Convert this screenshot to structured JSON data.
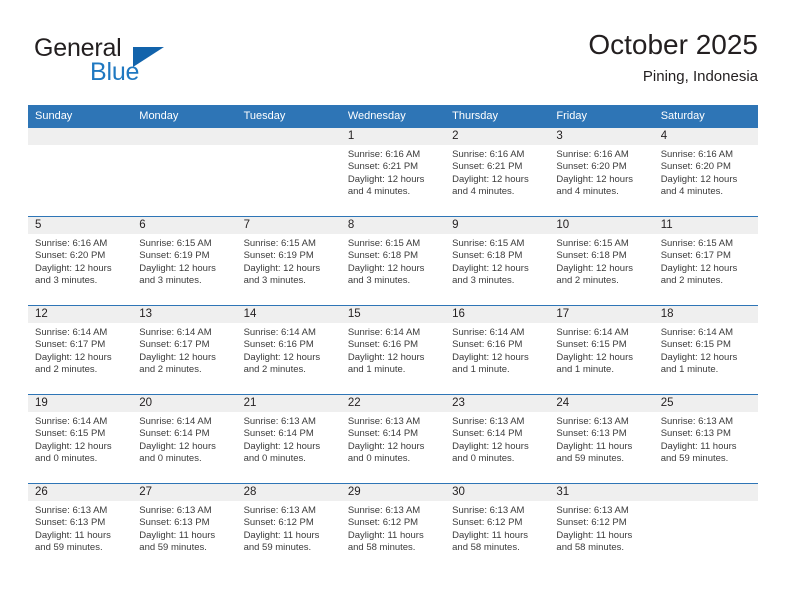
{
  "brand": {
    "word_one": "General",
    "word_two": "Blue",
    "logo_icon": "triangle-flag-icon",
    "accent_color": "#1263ab",
    "text_color": "#1f78c1"
  },
  "header": {
    "title": "October 2025",
    "subtitle": "Pining, Indonesia"
  },
  "theme": {
    "header_band": "#2e75b6",
    "date_band": "#efefef",
    "row_rule": "#2e75b6",
    "body_text": "#3b3b3b"
  },
  "weekday_headers": [
    "Sunday",
    "Monday",
    "Tuesday",
    "Wednesday",
    "Thursday",
    "Friday",
    "Saturday"
  ],
  "labels": {
    "sunrise_prefix": "Sunrise:",
    "sunset_prefix": "Sunset:",
    "daylight_prefix": "Daylight:"
  },
  "weeks": [
    [
      {
        "day": "",
        "empty": true
      },
      {
        "day": "",
        "empty": true
      },
      {
        "day": "",
        "empty": true
      },
      {
        "day": "1",
        "sunrise": "Sunrise: 6:16 AM",
        "sunset": "Sunset: 6:21 PM",
        "daylight": "Daylight: 12 hours and 4 minutes."
      },
      {
        "day": "2",
        "sunrise": "Sunrise: 6:16 AM",
        "sunset": "Sunset: 6:21 PM",
        "daylight": "Daylight: 12 hours and 4 minutes."
      },
      {
        "day": "3",
        "sunrise": "Sunrise: 6:16 AM",
        "sunset": "Sunset: 6:20 PM",
        "daylight": "Daylight: 12 hours and 4 minutes."
      },
      {
        "day": "4",
        "sunrise": "Sunrise: 6:16 AM",
        "sunset": "Sunset: 6:20 PM",
        "daylight": "Daylight: 12 hours and 4 minutes."
      }
    ],
    [
      {
        "day": "5",
        "sunrise": "Sunrise: 6:16 AM",
        "sunset": "Sunset: 6:20 PM",
        "daylight": "Daylight: 12 hours and 3 minutes."
      },
      {
        "day": "6",
        "sunrise": "Sunrise: 6:15 AM",
        "sunset": "Sunset: 6:19 PM",
        "daylight": "Daylight: 12 hours and 3 minutes."
      },
      {
        "day": "7",
        "sunrise": "Sunrise: 6:15 AM",
        "sunset": "Sunset: 6:19 PM",
        "daylight": "Daylight: 12 hours and 3 minutes."
      },
      {
        "day": "8",
        "sunrise": "Sunrise: 6:15 AM",
        "sunset": "Sunset: 6:18 PM",
        "daylight": "Daylight: 12 hours and 3 minutes."
      },
      {
        "day": "9",
        "sunrise": "Sunrise: 6:15 AM",
        "sunset": "Sunset: 6:18 PM",
        "daylight": "Daylight: 12 hours and 3 minutes."
      },
      {
        "day": "10",
        "sunrise": "Sunrise: 6:15 AM",
        "sunset": "Sunset: 6:18 PM",
        "daylight": "Daylight: 12 hours and 2 minutes."
      },
      {
        "day": "11",
        "sunrise": "Sunrise: 6:15 AM",
        "sunset": "Sunset: 6:17 PM",
        "daylight": "Daylight: 12 hours and 2 minutes."
      }
    ],
    [
      {
        "day": "12",
        "sunrise": "Sunrise: 6:14 AM",
        "sunset": "Sunset: 6:17 PM",
        "daylight": "Daylight: 12 hours and 2 minutes."
      },
      {
        "day": "13",
        "sunrise": "Sunrise: 6:14 AM",
        "sunset": "Sunset: 6:17 PM",
        "daylight": "Daylight: 12 hours and 2 minutes."
      },
      {
        "day": "14",
        "sunrise": "Sunrise: 6:14 AM",
        "sunset": "Sunset: 6:16 PM",
        "daylight": "Daylight: 12 hours and 2 minutes."
      },
      {
        "day": "15",
        "sunrise": "Sunrise: 6:14 AM",
        "sunset": "Sunset: 6:16 PM",
        "daylight": "Daylight: 12 hours and 1 minute."
      },
      {
        "day": "16",
        "sunrise": "Sunrise: 6:14 AM",
        "sunset": "Sunset: 6:16 PM",
        "daylight": "Daylight: 12 hours and 1 minute."
      },
      {
        "day": "17",
        "sunrise": "Sunrise: 6:14 AM",
        "sunset": "Sunset: 6:15 PM",
        "daylight": "Daylight: 12 hours and 1 minute."
      },
      {
        "day": "18",
        "sunrise": "Sunrise: 6:14 AM",
        "sunset": "Sunset: 6:15 PM",
        "daylight": "Daylight: 12 hours and 1 minute."
      }
    ],
    [
      {
        "day": "19",
        "sunrise": "Sunrise: 6:14 AM",
        "sunset": "Sunset: 6:15 PM",
        "daylight": "Daylight: 12 hours and 0 minutes."
      },
      {
        "day": "20",
        "sunrise": "Sunrise: 6:14 AM",
        "sunset": "Sunset: 6:14 PM",
        "daylight": "Daylight: 12 hours and 0 minutes."
      },
      {
        "day": "21",
        "sunrise": "Sunrise: 6:13 AM",
        "sunset": "Sunset: 6:14 PM",
        "daylight": "Daylight: 12 hours and 0 minutes."
      },
      {
        "day": "22",
        "sunrise": "Sunrise: 6:13 AM",
        "sunset": "Sunset: 6:14 PM",
        "daylight": "Daylight: 12 hours and 0 minutes."
      },
      {
        "day": "23",
        "sunrise": "Sunrise: 6:13 AM",
        "sunset": "Sunset: 6:14 PM",
        "daylight": "Daylight: 12 hours and 0 minutes."
      },
      {
        "day": "24",
        "sunrise": "Sunrise: 6:13 AM",
        "sunset": "Sunset: 6:13 PM",
        "daylight": "Daylight: 11 hours and 59 minutes."
      },
      {
        "day": "25",
        "sunrise": "Sunrise: 6:13 AM",
        "sunset": "Sunset: 6:13 PM",
        "daylight": "Daylight: 11 hours and 59 minutes."
      }
    ],
    [
      {
        "day": "26",
        "sunrise": "Sunrise: 6:13 AM",
        "sunset": "Sunset: 6:13 PM",
        "daylight": "Daylight: 11 hours and 59 minutes."
      },
      {
        "day": "27",
        "sunrise": "Sunrise: 6:13 AM",
        "sunset": "Sunset: 6:13 PM",
        "daylight": "Daylight: 11 hours and 59 minutes."
      },
      {
        "day": "28",
        "sunrise": "Sunrise: 6:13 AM",
        "sunset": "Sunset: 6:12 PM",
        "daylight": "Daylight: 11 hours and 59 minutes."
      },
      {
        "day": "29",
        "sunrise": "Sunrise: 6:13 AM",
        "sunset": "Sunset: 6:12 PM",
        "daylight": "Daylight: 11 hours and 58 minutes."
      },
      {
        "day": "30",
        "sunrise": "Sunrise: 6:13 AM",
        "sunset": "Sunset: 6:12 PM",
        "daylight": "Daylight: 11 hours and 58 minutes."
      },
      {
        "day": "31",
        "sunrise": "Sunrise: 6:13 AM",
        "sunset": "Sunset: 6:12 PM",
        "daylight": "Daylight: 11 hours and 58 minutes."
      },
      {
        "day": "",
        "empty": true
      }
    ]
  ]
}
